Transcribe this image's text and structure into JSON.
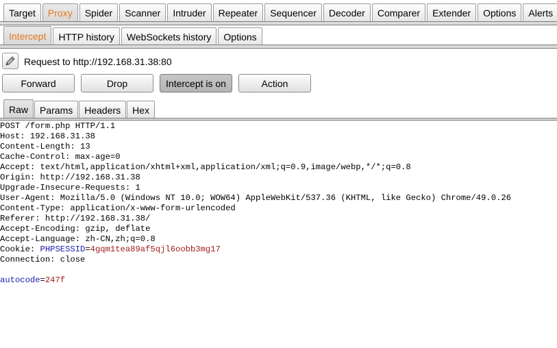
{
  "main_tabs": [
    "Target",
    "Proxy",
    "Spider",
    "Scanner",
    "Intruder",
    "Repeater",
    "Sequencer",
    "Decoder",
    "Comparer",
    "Extender",
    "Options",
    "Alerts"
  ],
  "main_active": "Proxy",
  "proxy_tabs": [
    "Intercept",
    "HTTP history",
    "WebSockets history",
    "Options"
  ],
  "proxy_active": "Intercept",
  "request_label": "Request to http://192.168.31.38:80",
  "buttons": {
    "forward": "Forward",
    "drop": "Drop",
    "intercept": "Intercept is on",
    "action": "Action"
  },
  "message_tabs": [
    "Raw",
    "Params",
    "Headers",
    "Hex"
  ],
  "message_active": "Raw",
  "request_lines": [
    "POST /form.php HTTP/1.1",
    "Host: 192.168.31.38",
    "Content-Length: 13",
    "Cache-Control: max-age=0",
    "Accept: text/html,application/xhtml+xml,application/xml;q=0.9,image/webp,*/*;q=0.8",
    "Origin: http://192.168.31.38",
    "Upgrade-Insecure-Requests: 1",
    "User-Agent: Mozilla/5.0 (Windows NT 10.0; WOW64) AppleWebKit/537.36 (KHTML, like Gecko) Chrome/49.0.26",
    "Content-Type: application/x-www-form-urlencoded",
    "Referer: http://192.168.31.38/",
    "Accept-Encoding: gzip, deflate",
    "Accept-Language: zh-CN,zh;q=0.8"
  ],
  "cookie": {
    "prefix": "Cookie: ",
    "name": "PHPSESSID",
    "sep": "=",
    "value": "4gqm1tea89af5qjl6oobb3mg17"
  },
  "connection_line": "Connection: close",
  "body_param": {
    "name": "autocode",
    "sep": "=",
    "value": "247f"
  },
  "colors": {
    "active_tab_text": "#e8791b",
    "param_name": "#1b1ba8",
    "param_value": "#a01e1e"
  },
  "icons": {
    "edit": "pencil-icon"
  }
}
